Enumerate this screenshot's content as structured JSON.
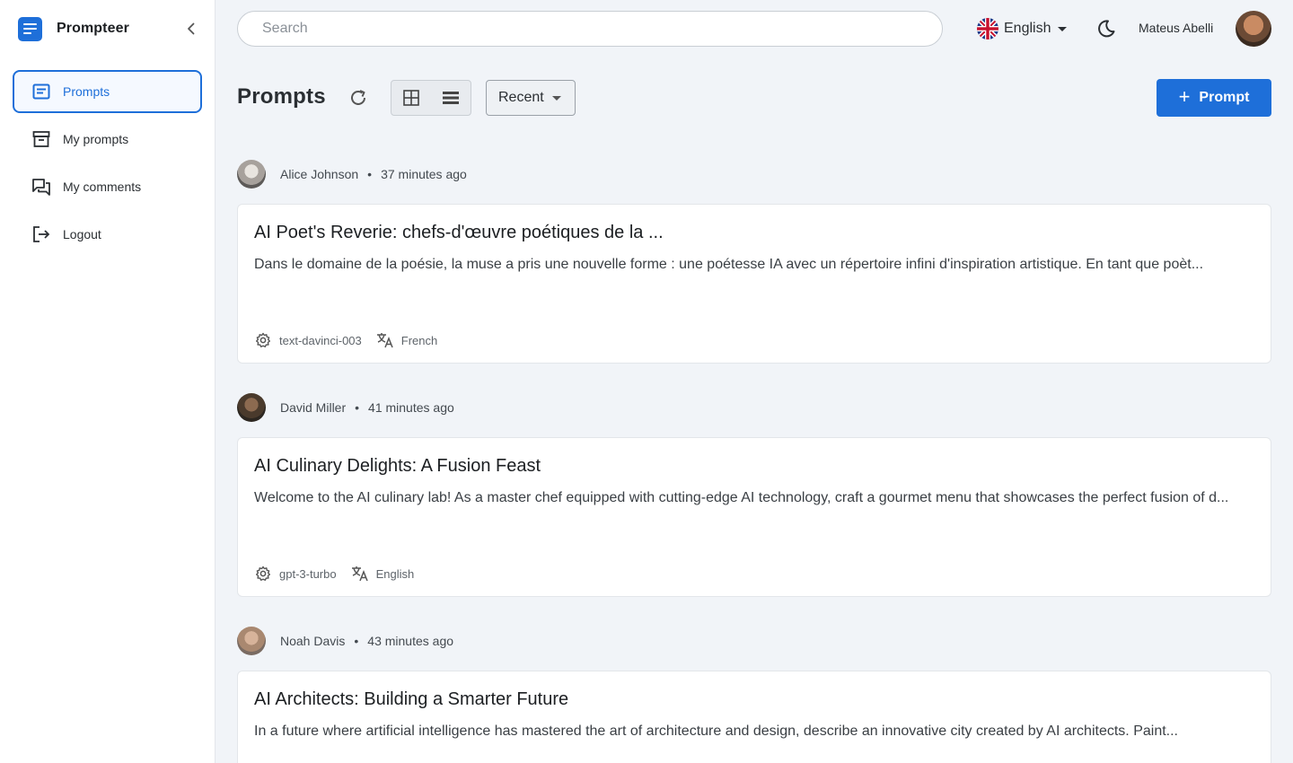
{
  "app": {
    "name": "Prompteer"
  },
  "sidebar": {
    "items": [
      {
        "label": "Prompts",
        "icon": "prompts-icon"
      },
      {
        "label": "My prompts",
        "icon": "archive-icon"
      },
      {
        "label": "My comments",
        "icon": "comments-icon"
      },
      {
        "label": "Logout",
        "icon": "logout-icon"
      }
    ]
  },
  "header": {
    "search_placeholder": "Search",
    "language": "English",
    "user": "Mateus Abelli"
  },
  "toolbar": {
    "title": "Prompts",
    "sort": "Recent",
    "new_label": "Prompt"
  },
  "posts": [
    {
      "author": "Alice Johnson",
      "time": "37 minutes ago",
      "title": "AI Poet's Reverie: chefs-d'œuvre poétiques de la ...",
      "description": "Dans le domaine de la poésie, la muse a pris une nouvelle forme : une poétesse IA avec un répertoire infini d'inspiration artistique. En tant que poèt...",
      "model": "text-davinci-003",
      "language": "French"
    },
    {
      "author": "David Miller",
      "time": "41 minutes ago",
      "title": "AI Culinary Delights: A Fusion Feast",
      "description": "Welcome to the AI culinary lab! As a master chef equipped with cutting-edge AI technology, craft a gourmet menu that showcases the perfect fusion of d...",
      "model": "gpt-3-turbo",
      "language": "English"
    },
    {
      "author": "Noah Davis",
      "time": "43 minutes ago",
      "title": "AI Architects: Building a Smarter Future",
      "description": "In a future where artificial intelligence has mastered the art of architecture and design, describe an innovative city created by AI architects. Paint...",
      "model": "",
      "language": ""
    }
  ],
  "colors": {
    "accent": "#1e6fd9",
    "background": "#f1f4f8"
  }
}
